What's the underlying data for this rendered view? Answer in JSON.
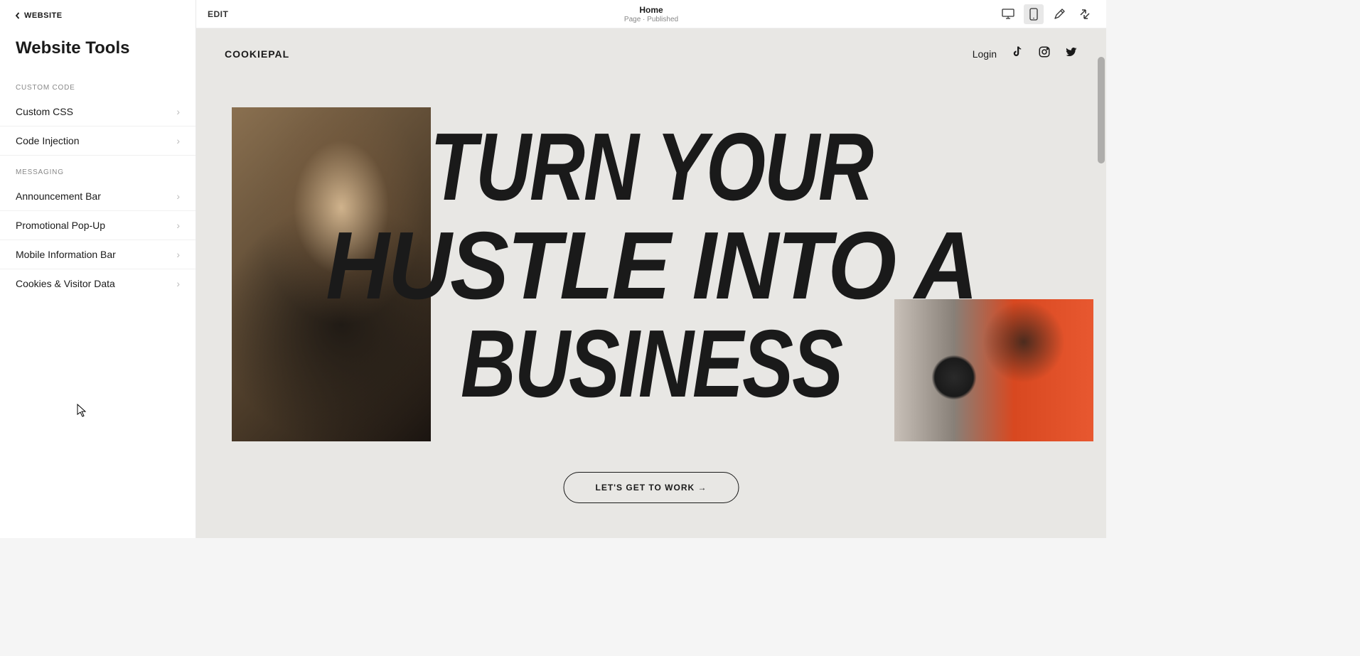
{
  "sidebar": {
    "back_label": "WEBSITE",
    "title": "Website Tools",
    "sections": [
      {
        "header": "CUSTOM CODE",
        "items": [
          "Custom CSS",
          "Code Injection"
        ]
      },
      {
        "header": "MESSAGING",
        "items": [
          "Announcement Bar",
          "Promotional Pop-Up",
          "Mobile Information Bar",
          "Cookies & Visitor Data"
        ]
      }
    ]
  },
  "topbar": {
    "edit_label": "EDIT",
    "page_title": "Home",
    "page_meta": "Page · Published"
  },
  "preview": {
    "brand": "COOKIEPAL",
    "login": "Login",
    "hero_line1": "TURN YOUR",
    "hero_line2": "HUSTLE INTO A",
    "hero_line3": "BUSINESS",
    "cta": "LET'S GET TO WORK →"
  },
  "icons": {
    "back": "chevron-left-icon",
    "item_chevron": "chevron-right-icon",
    "desktop": "desktop-icon",
    "mobile": "mobile-icon",
    "brush": "paintbrush-icon",
    "expand": "expand-icon",
    "tiktok": "tiktok-icon",
    "instagram": "instagram-icon",
    "twitter": "twitter-icon"
  }
}
